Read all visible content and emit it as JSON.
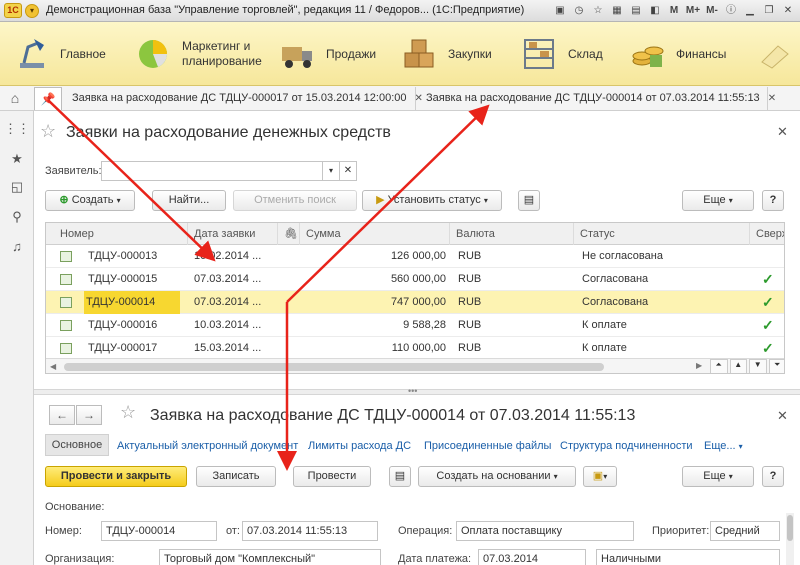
{
  "window": {
    "title": "Демонстрационная база \"Управление торговлей\", редакция 11 / Федоров... (1С:Предприятие)",
    "logo": "1С",
    "icons": [
      "save-icon",
      "history-icon",
      "favorites-icon",
      "calc-icon",
      "calendar-icon",
      "compare-icon",
      "M",
      "M+",
      "M-",
      "info-icon",
      "minimize-icon",
      "restore-icon",
      "close-icon"
    ],
    "memory_labels": [
      "M",
      "M+",
      "M-"
    ]
  },
  "sections": [
    {
      "label": "Главное",
      "icon": "lamp-icon"
    },
    {
      "label": "Маркетинг и планирование",
      "icon": "chart-pie-icon"
    },
    {
      "label": "Продажи",
      "icon": "truck-icon"
    },
    {
      "label": "Закупки",
      "icon": "boxes-icon"
    },
    {
      "label": "Склад",
      "icon": "warehouse-icon"
    },
    {
      "label": "Финансы",
      "icon": "coins-icon"
    }
  ],
  "open_tabs": [
    {
      "label": "Заявка на расходование ДС ТДЦУ-000017 от 15.03.2014 12:00:00"
    },
    {
      "label": "Заявка на расходование ДС ТДЦУ-000014 от 07.03.2014 11:55:13"
    }
  ],
  "list_form": {
    "title": "Заявки на расходование денежных средств",
    "applicant_label": "Заявитель:",
    "applicant_value": "",
    "buttons": {
      "create": "Создать",
      "find": "Найти...",
      "cancel_search": "Отменить поиск",
      "set_status": "Установить статус",
      "more": "Еще",
      "help": "?"
    },
    "columns": [
      "Номер",
      "Дата заявки",
      "",
      "Сумма",
      "Валюта",
      "Статус",
      "Сверх"
    ],
    "rows": [
      {
        "number": "ТДЦУ-000013",
        "date": "10.02.2014 ...",
        "sum": "126 000,00",
        "currency": "RUB",
        "status": "Не согласована",
        "over": ""
      },
      {
        "number": "ТДЦУ-000015",
        "date": "07.03.2014 ...",
        "sum": "560 000,00",
        "currency": "RUB",
        "status": "Согласована",
        "over": "✓"
      },
      {
        "number": "ТДЦУ-000014",
        "date": "07.03.2014 ...",
        "sum": "747 000,00",
        "currency": "RUB",
        "status": "Согласована",
        "over": "✓"
      },
      {
        "number": "ТДЦУ-000016",
        "date": "10.03.2014 ...",
        "sum": "9 588,28",
        "currency": "RUB",
        "status": "К оплате",
        "over": "✓"
      },
      {
        "number": "ТДЦУ-000017",
        "date": "15.03.2014 ...",
        "sum": "110 000,00",
        "currency": "RUB",
        "status": "К оплате",
        "over": "✓"
      }
    ],
    "selected_row": 2
  },
  "doc_form": {
    "title": "Заявка на расходование ДС ТДЦУ-000014 от 07.03.2014 11:55:13",
    "nav": {
      "back": "←",
      "forward": "→"
    },
    "links": {
      "main": "Основное",
      "edoc": "Актуальный электронный документ",
      "limits": "Лимиты расхода ДС",
      "files": "Присоединенные файлы",
      "structure": "Структура подчиненности",
      "more": "Еще..."
    },
    "buttons": {
      "post_close": "Провести и закрыть",
      "write": "Записать",
      "post": "Провести",
      "create_based": "Создать на основании",
      "more": "Еще",
      "help": "?"
    },
    "fields": {
      "basis_label": "Основание:",
      "number_label": "Номер:",
      "number_value": "ТДЦУ-000014",
      "from_label": "от:",
      "from_value": "07.03.2014 11:55:13",
      "operation_label": "Операция:",
      "operation_value": "Оплата поставщику",
      "priority_label": "Приоритет:",
      "priority_value": "Средний",
      "org_label": "Организация:",
      "org_value": "Торговый дом \"Комплексный\"",
      "paydate_label": "Дата платежа:",
      "paydate_value": "07.03.2014",
      "payform_value": "Наличными"
    }
  },
  "colors": {
    "accent_yellow": "#f5cc1c",
    "selection": "#fdf3b2",
    "arrow": "#e8231a",
    "link": "#1a5ea8"
  }
}
